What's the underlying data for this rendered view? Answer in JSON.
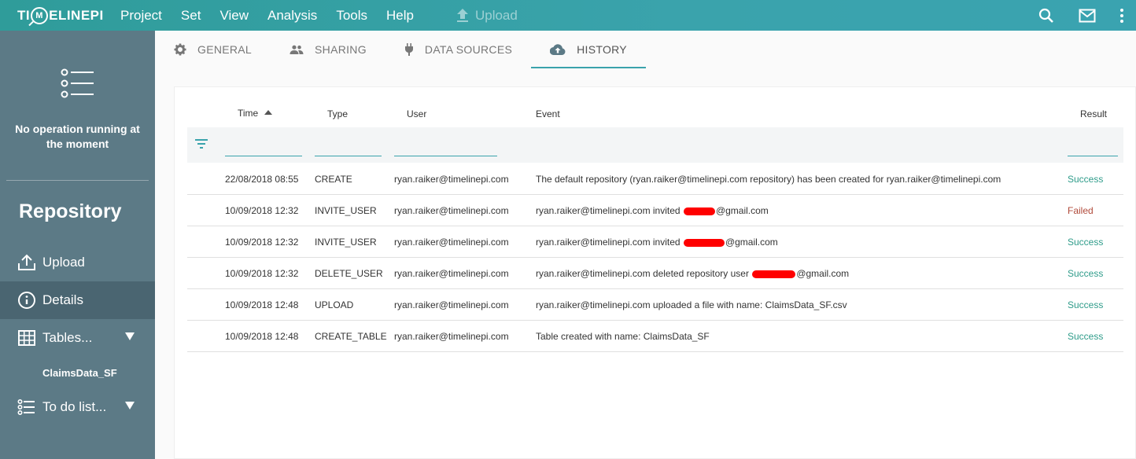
{
  "app": {
    "logo": {
      "left": "TI",
      "ring": "M",
      "right": "ELINEPI"
    },
    "menu": [
      "Project",
      "Set",
      "View",
      "Analysis",
      "Tools",
      "Help"
    ],
    "upload_label": "Upload"
  },
  "sidebar": {
    "status": "No operation running at the moment",
    "title": "Repository",
    "items": [
      {
        "label": "Upload"
      },
      {
        "label": "Details"
      },
      {
        "label": "Tables..."
      },
      {
        "label": "To do list..."
      }
    ],
    "sub_item": "ClaimsData_SF"
  },
  "tabs": [
    "GENERAL",
    "SHARING",
    "DATA SOURCES",
    "HISTORY"
  ],
  "table": {
    "columns": {
      "time": "Time",
      "type": "Type",
      "user": "User",
      "event": "Event",
      "result": "Result"
    },
    "rows": [
      {
        "time": "22/08/2018 08:55",
        "type": "CREATE",
        "user": "ryan.raiker@timelinepi.com",
        "event_a": "The default repository (ryan.raiker@timelinepi.com repository) has been created for ryan.raiker@timelinepi.com",
        "event_b": "",
        "result": "Success"
      },
      {
        "time": "10/09/2018 12:32",
        "type": "INVITE_USER",
        "user": "ryan.raiker@timelinepi.com",
        "event_a": "ryan.raiker@timelinepi.com invited",
        "event_b": "@gmail.com",
        "result": "Failed"
      },
      {
        "time": "10/09/2018 12:32",
        "type": "INVITE_USER",
        "user": "ryan.raiker@timelinepi.com",
        "event_a": "ryan.raiker@timelinepi.com invited",
        "event_b": "@gmail.com",
        "result": "Success"
      },
      {
        "time": "10/09/2018 12:32",
        "type": "DELETE_USER",
        "user": "ryan.raiker@timelinepi.com",
        "event_a": "ryan.raiker@timelinepi.com deleted repository user",
        "event_b": "@gmail.com",
        "result": "Success"
      },
      {
        "time": "10/09/2018 12:48",
        "type": "UPLOAD",
        "user": "ryan.raiker@timelinepi.com",
        "event_a": "ryan.raiker@timelinepi.com uploaded a file with name: ClaimsData_SF.csv",
        "event_b": "",
        "result": "Success"
      },
      {
        "time": "10/09/2018 12:48",
        "type": "CREATE_TABLE",
        "user": "ryan.raiker@timelinepi.com",
        "event_a": "Table created with name: ClaimsData_SF",
        "event_b": "",
        "result": "Success"
      }
    ]
  },
  "colors": {
    "accent": "#3aa3ac",
    "sidebar": "#5c7a86",
    "success": "#2f9c8a",
    "failed": "#b04a3a",
    "redaction": "#ff0000"
  }
}
